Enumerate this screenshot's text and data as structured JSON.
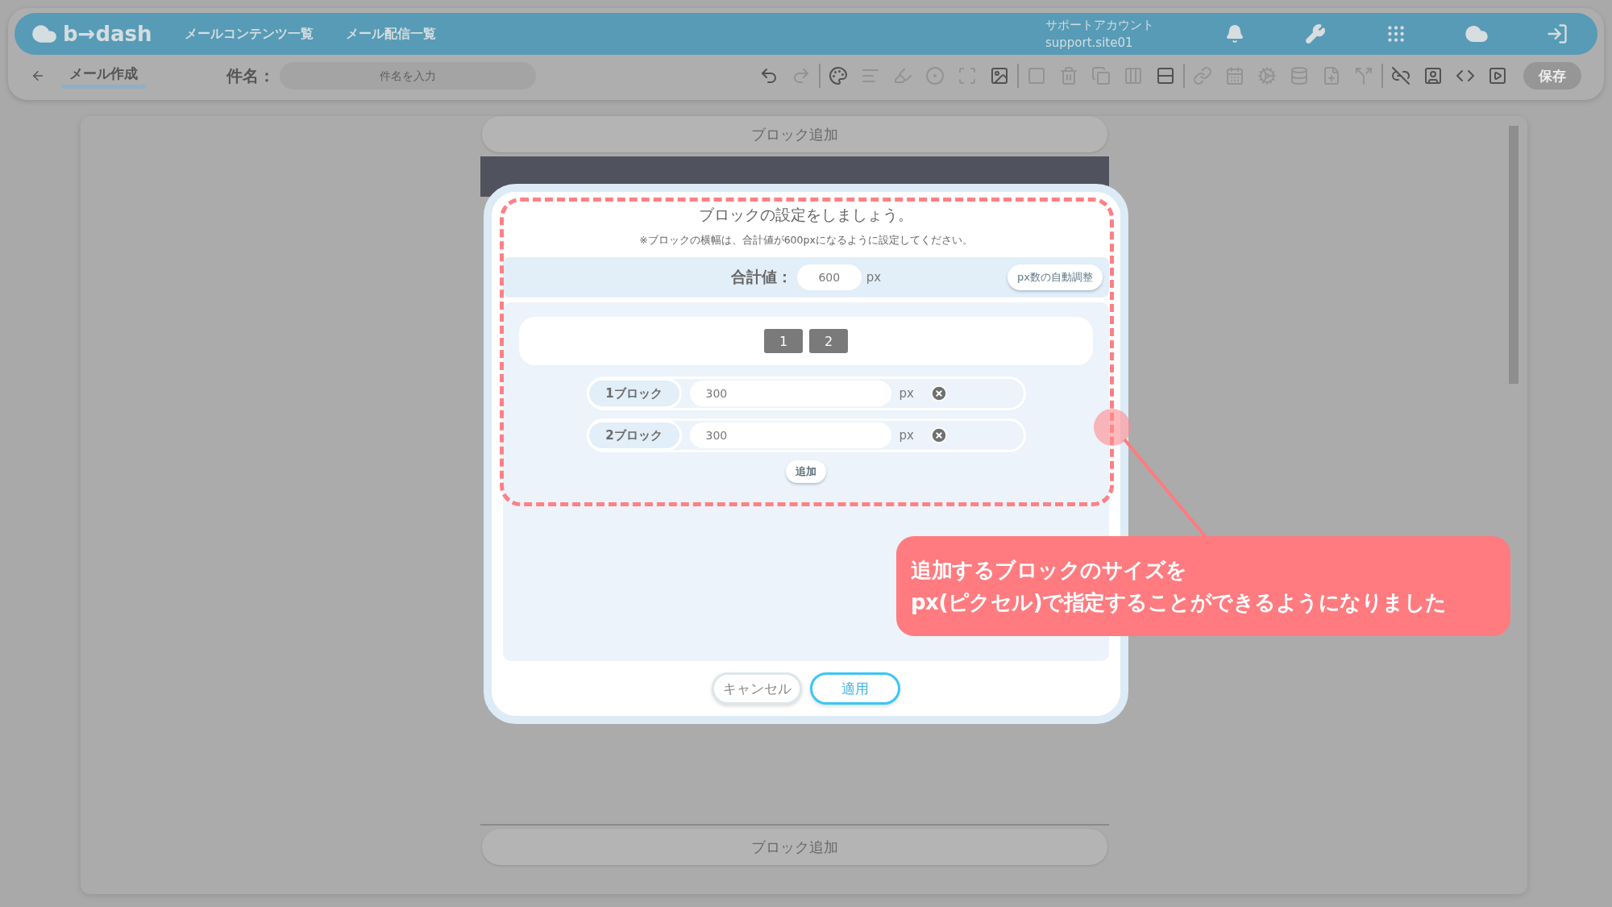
{
  "header": {
    "logo_text": "b→dash",
    "nav": [
      {
        "label": "メールコンテンツ一覧"
      },
      {
        "label": "メール配信一覧"
      }
    ],
    "account": {
      "name": "サポートアカウント",
      "id": "support.site01"
    }
  },
  "subbar": {
    "tab": {
      "label": "メール作成",
      "selected": true
    },
    "subject": {
      "label": "件名：",
      "placeholder": "件名を入力"
    },
    "tools": [
      {
        "kind": "undo",
        "disabled": false
      },
      {
        "kind": "redo",
        "disabled": true
      },
      {
        "kind": "separator"
      },
      {
        "kind": "palette",
        "disabled": false
      },
      {
        "kind": "align",
        "disabled": true
      },
      {
        "kind": "highlighter",
        "disabled": true
      },
      {
        "kind": "target",
        "disabled": true
      },
      {
        "kind": "frame",
        "disabled": true
      },
      {
        "kind": "image",
        "disabled": false
      },
      {
        "kind": "separator"
      },
      {
        "kind": "square",
        "disabled": true
      },
      {
        "kind": "trash",
        "disabled": true
      },
      {
        "kind": "copy",
        "disabled": true
      },
      {
        "kind": "columns",
        "disabled": true
      },
      {
        "kind": "rows",
        "disabled": false
      },
      {
        "kind": "separator"
      },
      {
        "kind": "link",
        "disabled": true
      },
      {
        "kind": "calendar",
        "disabled": true
      },
      {
        "kind": "cogs",
        "disabled": true
      },
      {
        "kind": "database",
        "disabled": true
      },
      {
        "kind": "add-note",
        "disabled": true
      },
      {
        "kind": "split",
        "disabled": true
      },
      {
        "kind": "separator"
      },
      {
        "kind": "unlink",
        "disabled": false
      },
      {
        "kind": "user",
        "disabled": false
      },
      {
        "kind": "html",
        "disabled": false
      },
      {
        "kind": "play",
        "disabled": false
      }
    ],
    "save": {
      "label": "保存",
      "disabled": true
    }
  },
  "editor": {
    "add_block_top": "ブロック追加",
    "add_block_bottom": "ブロック追加"
  },
  "dialog": {
    "title": "ブロックの設定をしましょう。",
    "note": "※ブロックの横幅は、合計値が600pxになるように設定してください。",
    "total": {
      "label": "合計値：",
      "value": "600",
      "unit": "px"
    },
    "auto_button": "px数の自動調整",
    "segments": [
      {
        "label": "1"
      },
      {
        "label": "2"
      }
    ],
    "blocks": [
      {
        "label": "1ブロック",
        "value": "300",
        "unit": "px"
      },
      {
        "label": "2ブロック",
        "value": "300",
        "unit": "px"
      }
    ],
    "add_button": "追加",
    "cancel_button": "キャンセル",
    "apply_button": "適用"
  },
  "annotation": {
    "text": "追加するブロックのサイズを\npx(ピクセル)で指定することができるようになりました"
  }
}
